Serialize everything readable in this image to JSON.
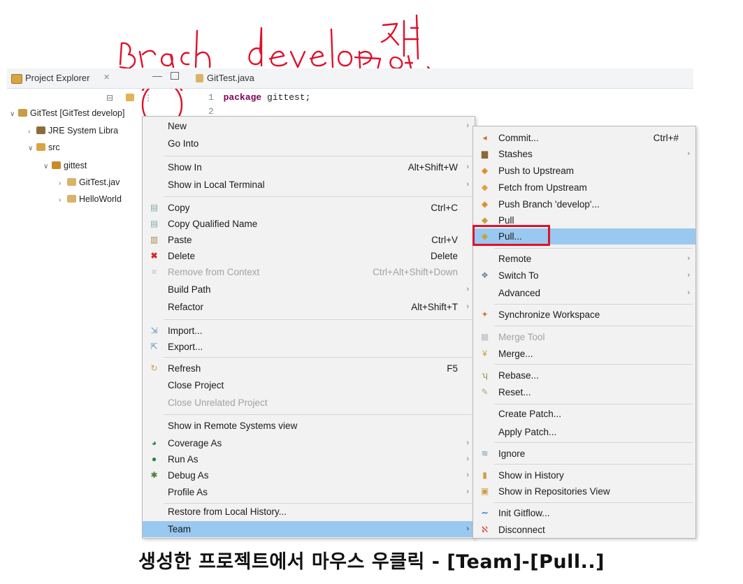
{
  "annotation": {
    "text_en": "branch develop에서",
    "text_kr": "진행."
  },
  "project_explorer": {
    "title": "Project Explorer",
    "tree": [
      {
        "label": "GitTest [GitTest develop]"
      },
      {
        "label": "JRE System Libra"
      },
      {
        "label": "src"
      },
      {
        "label": "gittest"
      },
      {
        "label": "GitTest.jav"
      },
      {
        "label": "HelloWorld"
      }
    ]
  },
  "editor": {
    "tab_label": "GitTest.java",
    "lines": [
      {
        "num": "1",
        "keyword": "package",
        "text": " gittest;"
      },
      {
        "num": "2",
        "keyword": "",
        "text": ""
      }
    ]
  },
  "context_menu": {
    "items": [
      {
        "label": "New",
        "shortcut": "",
        "arrow": "›"
      },
      {
        "label": "Go Into",
        "shortcut": "",
        "arrow": ""
      },
      {
        "label": "Show In",
        "shortcut": "Alt+Shift+W",
        "arrow": "›"
      },
      {
        "label": "Show in Local Terminal",
        "shortcut": "",
        "arrow": "›"
      },
      {
        "label": "Copy",
        "shortcut": "Ctrl+C",
        "arrow": ""
      },
      {
        "label": "Copy Qualified Name",
        "shortcut": "",
        "arrow": ""
      },
      {
        "label": "Paste",
        "shortcut": "Ctrl+V",
        "arrow": ""
      },
      {
        "label": "Delete",
        "shortcut": "Delete",
        "arrow": ""
      },
      {
        "label": "Remove from Context",
        "shortcut": "Ctrl+Alt+Shift+Down",
        "arrow": ""
      },
      {
        "label": "Build Path",
        "shortcut": "",
        "arrow": "›"
      },
      {
        "label": "Refactor",
        "shortcut": "Alt+Shift+T",
        "arrow": "›"
      },
      {
        "label": "Import...",
        "shortcut": "",
        "arrow": ""
      },
      {
        "label": "Export...",
        "shortcut": "",
        "arrow": ""
      },
      {
        "label": "Refresh",
        "shortcut": "F5",
        "arrow": ""
      },
      {
        "label": "Close Project",
        "shortcut": "",
        "arrow": ""
      },
      {
        "label": "Close Unrelated Project",
        "shortcut": "",
        "arrow": ""
      },
      {
        "label": "Show in Remote Systems view",
        "shortcut": "",
        "arrow": ""
      },
      {
        "label": "Coverage As",
        "shortcut": "",
        "arrow": "›"
      },
      {
        "label": "Run As",
        "shortcut": "",
        "arrow": "›"
      },
      {
        "label": "Debug As",
        "shortcut": "",
        "arrow": "›"
      },
      {
        "label": "Profile As",
        "shortcut": "",
        "arrow": "›"
      },
      {
        "label": "Restore from Local History...",
        "shortcut": "",
        "arrow": ""
      },
      {
        "label": "Team",
        "shortcut": "",
        "arrow": "›"
      }
    ]
  },
  "team_submenu": {
    "items": [
      {
        "label": "Commit...",
        "shortcut": "Ctrl+#",
        "arrow": ""
      },
      {
        "label": "Stashes",
        "shortcut": "",
        "arrow": "›"
      },
      {
        "label": "Push to Upstream",
        "shortcut": "",
        "arrow": ""
      },
      {
        "label": "Fetch from Upstream",
        "shortcut": "",
        "arrow": ""
      },
      {
        "label": "Push Branch 'develop'...",
        "shortcut": "",
        "arrow": ""
      },
      {
        "label": "Pull",
        "shortcut": "",
        "arrow": ""
      },
      {
        "label": "Pull...",
        "shortcut": "",
        "arrow": ""
      },
      {
        "label": "Remote",
        "shortcut": "",
        "arrow": "›"
      },
      {
        "label": "Switch To",
        "shortcut": "",
        "arrow": "›"
      },
      {
        "label": "Advanced",
        "shortcut": "",
        "arrow": "›"
      },
      {
        "label": "Synchronize Workspace",
        "shortcut": "",
        "arrow": ""
      },
      {
        "label": "Merge Tool",
        "shortcut": "",
        "arrow": ""
      },
      {
        "label": "Merge...",
        "shortcut": "",
        "arrow": ""
      },
      {
        "label": "Rebase...",
        "shortcut": "",
        "arrow": ""
      },
      {
        "label": "Reset...",
        "shortcut": "",
        "arrow": ""
      },
      {
        "label": "Create Patch...",
        "shortcut": "",
        "arrow": ""
      },
      {
        "label": "Apply Patch...",
        "shortcut": "",
        "arrow": ""
      },
      {
        "label": "Ignore",
        "shortcut": "",
        "arrow": ""
      },
      {
        "label": "Show in History",
        "shortcut": "",
        "arrow": ""
      },
      {
        "label": "Show in Repositories View",
        "shortcut": "",
        "arrow": ""
      },
      {
        "label": "Init Gitflow...",
        "shortcut": "",
        "arrow": ""
      },
      {
        "label": "Disconnect",
        "shortcut": "",
        "arrow": ""
      }
    ]
  },
  "caption": "생성한 프로젝트에서 마우스 우클릭 - [Team]-[Pull..]",
  "colors": {
    "highlight": "#99c8f0",
    "annotation_red": "#e0102a",
    "keyword": "#7f0055"
  }
}
